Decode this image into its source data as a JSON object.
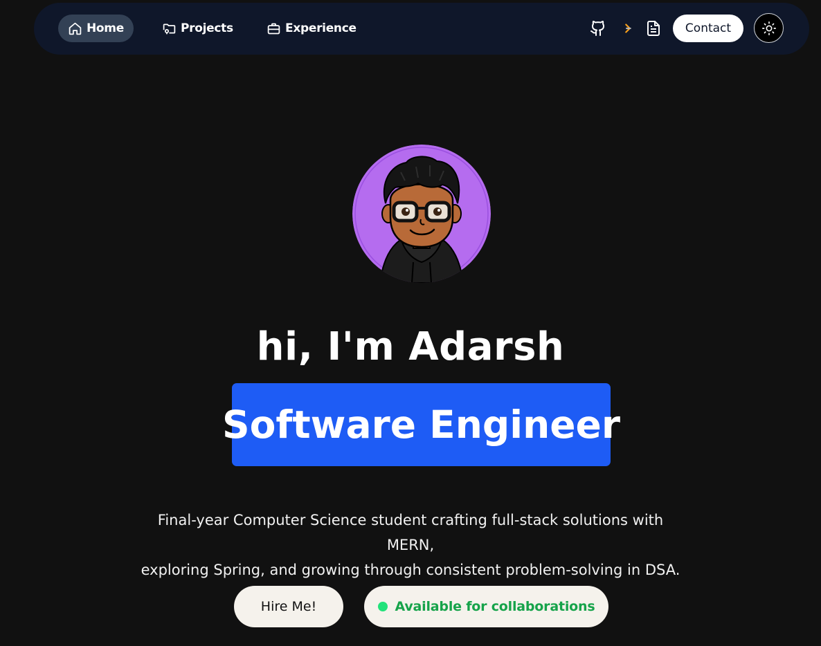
{
  "nav": {
    "items": [
      {
        "label": "Home",
        "icon": "home-icon",
        "active": true
      },
      {
        "label": "Projects",
        "icon": "folder-icon",
        "active": false
      },
      {
        "label": "Experience",
        "icon": "briefcase-icon",
        "active": false
      }
    ],
    "social_icons": [
      "github-icon",
      "leetcode-icon",
      "resume-document-icon"
    ],
    "contact_label": "Contact",
    "theme_icon": "sun-icon"
  },
  "hero": {
    "avatar": "avatar-illustration",
    "greeting": "hi, I'm Adarsh",
    "role": "Software Engineer",
    "description_line1": "Final-year Computer Science student crafting full-stack solutions with MERN,",
    "description_line2": "exploring Spring, and growing through consistent problem-solving in DSA.",
    "hire_label": "Hire Me!",
    "status_label": "Available for collaborations"
  },
  "colors": {
    "background": "#111111",
    "navbar": "#0f172a",
    "role_highlight": "#1e5cf5",
    "avatar_bg": "#b56cef",
    "status_green": "#16a34a"
  }
}
